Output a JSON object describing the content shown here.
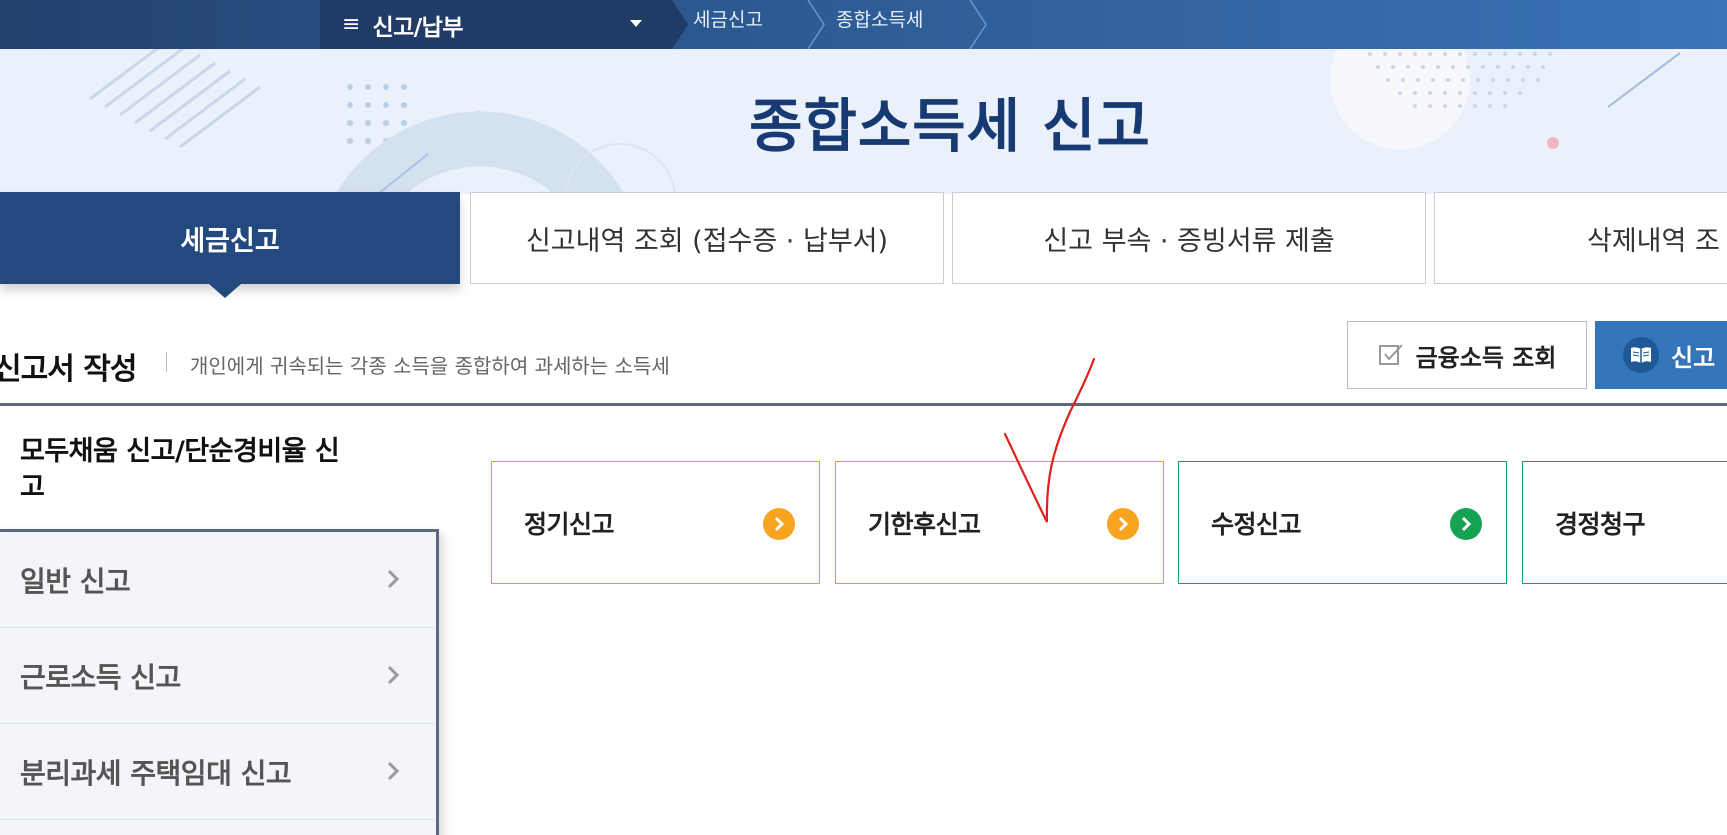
{
  "topbar": {
    "menu_label": "신고/납부",
    "breadcrumbs": [
      "세금신고",
      "종합소득세"
    ]
  },
  "hero": {
    "title": "종합소득세 신고"
  },
  "tabs": [
    {
      "label": "세금신고",
      "active": true
    },
    {
      "label": "신고내역 조회 (접수증 · 납부서)",
      "active": false
    },
    {
      "label": "신고 부속 · 증빙서류 제출",
      "active": false
    },
    {
      "label": "삭제내역 조",
      "active": false
    }
  ],
  "section": {
    "title": "신고서 작성",
    "description": "개인에게 귀속되는 각종 소득을 종합하여 과세하는 소득세",
    "buttons": {
      "financial_income": "금융소득 조회",
      "guide": "신고"
    }
  },
  "sidebar": {
    "heading": "모두채움 신고/단순경비율 신고",
    "items": [
      {
        "label": "일반 신고"
      },
      {
        "label": "근로소득 신고"
      },
      {
        "label": "분리과세 주택임대 신고"
      }
    ]
  },
  "cards": [
    {
      "label": "정기신고",
      "accent": "#f7a520"
    },
    {
      "label": "기한후신고",
      "accent": "#f7a520"
    },
    {
      "label": "수정신고",
      "accent": "#14a453"
    },
    {
      "label": "경정청구",
      "accent": "#14a453"
    }
  ],
  "colors": {
    "nav_dark": "#1f3b66",
    "primary": "#23497e",
    "button_blue": "#3474b9",
    "hero_bg": "#eaf1fa",
    "title_navy": "#173a73",
    "annotation": "#e0201c"
  },
  "icons": {
    "menu": "hamburger-icon",
    "dropdown": "caret-down-icon",
    "check": "checkbox-icon",
    "guide": "book-icon",
    "go": "chevron-right-circle-icon",
    "side_arrow": "chevron-right-icon"
  }
}
